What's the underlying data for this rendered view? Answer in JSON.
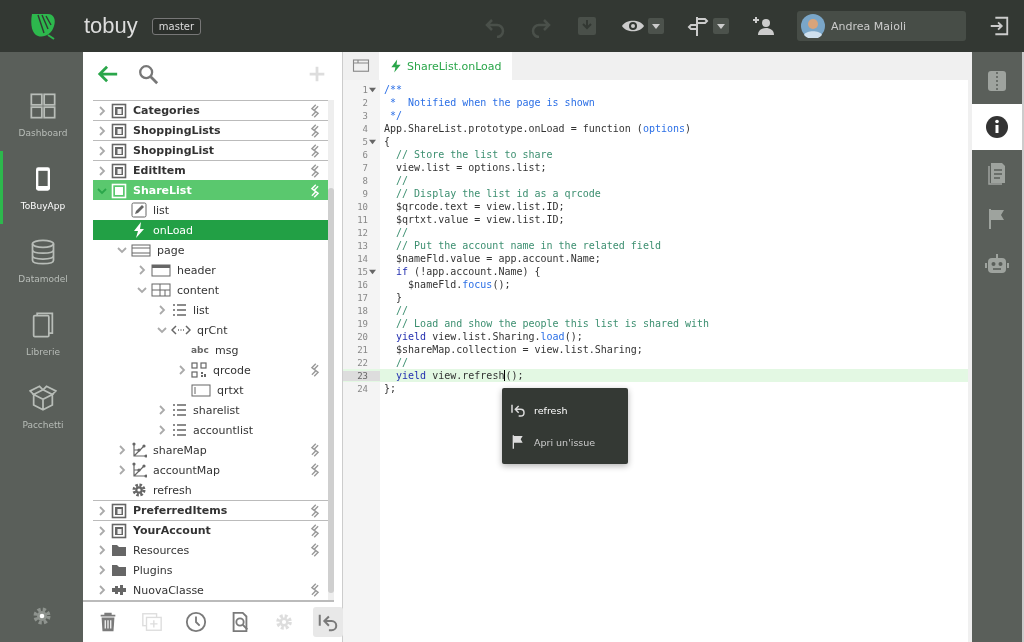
{
  "app": {
    "name": "tobuy",
    "branch": "master"
  },
  "toolbar": [
    {
      "disabled": true,
      "dropdown": false
    },
    {
      "disabled": true,
      "dropdown": false
    },
    {
      "disabled": true,
      "dropdown": false
    },
    {
      "disabled": false,
      "dropdown": true
    },
    {
      "disabled": false,
      "dropdown": true
    },
    {
      "disabled": false,
      "dropdown": false
    }
  ],
  "user": {
    "name": "Andrea Maioli"
  },
  "nav": [
    {
      "label": "Dashboard",
      "selected": false
    },
    {
      "label": "ToBuyApp",
      "selected": true
    },
    {
      "label": "Datamodel",
      "selected": false
    },
    {
      "label": "Librerie",
      "selected": false
    },
    {
      "label": "Pacchetti",
      "selected": false
    }
  ],
  "tree_toolbar": [
    {
      "disabled": false
    },
    {
      "disabled": false
    },
    {
      "disabled": true
    }
  ],
  "tree": [
    {
      "name": "Categories",
      "kind": "page",
      "expanded": false,
      "selected": false,
      "linked": true
    },
    {
      "name": "ShoppingLists",
      "kind": "page",
      "expanded": false,
      "selected": false,
      "linked": true
    },
    {
      "name": "ShoppingList",
      "kind": "page",
      "expanded": false,
      "selected": false,
      "linked": true
    },
    {
      "name": "EditItem",
      "kind": "page",
      "expanded": false,
      "selected": false,
      "linked": true
    },
    {
      "name": "ShareList",
      "kind": "page",
      "expanded": true,
      "selected": true,
      "linked": true,
      "children": [
        {
          "name": "list",
          "kind": "property",
          "selected": false,
          "linked": false
        },
        {
          "name": "onLoad",
          "kind": "event",
          "selected": true,
          "linked": false
        },
        {
          "name": "page",
          "kind": "layout",
          "expanded": true,
          "selected": false,
          "linked": false,
          "children": [
            {
              "name": "header",
              "kind": "header",
              "expanded": false,
              "selected": false,
              "linked": false
            },
            {
              "name": "content",
              "kind": "content",
              "expanded": true,
              "selected": false,
              "linked": false,
              "children": [
                {
                  "name": "list",
                  "kind": "list",
                  "expanded": false,
                  "selected": false,
                  "linked": false
                },
                {
                  "name": "qrCnt",
                  "kind": "container",
                  "expanded": true,
                  "selected": false,
                  "linked": false,
                  "children": [
                    {
                      "name": "msg",
                      "kind": "label",
                      "icon_text": "abc",
                      "selected": false,
                      "linked": false
                    },
                    {
                      "name": "qrcode",
                      "kind": "qrcode",
                      "expanded": false,
                      "selected": false,
                      "linked": true
                    },
                    {
                      "name": "qrtxt",
                      "kind": "input",
                      "selected": false,
                      "linked": false
                    }
                  ]
                },
                {
                  "name": "sharelist",
                  "kind": "list",
                  "expanded": false,
                  "selected": false,
                  "linked": false
                },
                {
                  "name": "accountlist",
                  "kind": "list",
                  "expanded": false,
                  "selected": false,
                  "linked": false
                }
              ]
            }
          ]
        },
        {
          "name": "shareMap",
          "kind": "map",
          "expanded": false,
          "selected": false,
          "linked": true
        },
        {
          "name": "accountMap",
          "kind": "map",
          "expanded": false,
          "selected": false,
          "linked": true
        },
        {
          "name": "refresh",
          "kind": "method",
          "selected": false,
          "linked": false
        }
      ]
    },
    {
      "name": "PreferredItems",
      "kind": "page",
      "expanded": false,
      "selected": false,
      "linked": true
    },
    {
      "name": "YourAccount",
      "kind": "page",
      "expanded": false,
      "selected": false,
      "linked": true
    },
    {
      "name": "Resources",
      "kind": "folder",
      "expanded": false,
      "selected": false,
      "linked": true
    },
    {
      "name": "Plugins",
      "kind": "folder",
      "expanded": false,
      "selected": false,
      "linked": false
    },
    {
      "name": "NuovaClasse",
      "kind": "class",
      "expanded": false,
      "selected": false,
      "linked": true
    }
  ],
  "tree_actions": [
    {
      "disabled": false,
      "pressed": false
    },
    {
      "disabled": true,
      "pressed": false
    },
    {
      "disabled": false,
      "pressed": false
    },
    {
      "disabled": false,
      "pressed": false
    },
    {
      "disabled": true,
      "pressed": false
    },
    {
      "disabled": false,
      "pressed": true
    }
  ],
  "editor": {
    "tab": "ShareList.onLoad",
    "lines": [
      {
        "num": "1",
        "fold": true,
        "active": false,
        "tokens": [
          {
            "t": "/**",
            "kind": "doc"
          }
        ]
      },
      {
        "num": "2",
        "fold": false,
        "active": false,
        "tokens": [
          {
            "t": " *  Notified when the page is shown",
            "kind": "doc"
          }
        ]
      },
      {
        "num": "3",
        "fold": false,
        "active": false,
        "tokens": [
          {
            "t": " */",
            "kind": "doc"
          }
        ]
      },
      {
        "num": "4",
        "fold": false,
        "active": false,
        "tokens": [
          {
            "t": "App.ShareList.prototype.onLoad = function (",
            "kind": "plain"
          },
          {
            "t": "options",
            "kind": "method"
          },
          {
            "t": ")",
            "kind": "plain"
          }
        ]
      },
      {
        "num": "5",
        "fold": true,
        "active": false,
        "tokens": [
          {
            "t": "{",
            "kind": "plain"
          }
        ]
      },
      {
        "num": "6",
        "fold": false,
        "active": false,
        "tokens": [
          {
            "t": "  // Store the list to share",
            "kind": "comment"
          }
        ]
      },
      {
        "num": "7",
        "fold": false,
        "active": false,
        "tokens": [
          {
            "t": "  view.list = options.list;",
            "kind": "plain"
          }
        ]
      },
      {
        "num": "8",
        "fold": false,
        "active": false,
        "tokens": [
          {
            "t": "  //",
            "kind": "comment"
          }
        ]
      },
      {
        "num": "9",
        "fold": false,
        "active": false,
        "tokens": [
          {
            "t": "  // Display the list id as a qrcode",
            "kind": "comment"
          }
        ]
      },
      {
        "num": "10",
        "fold": false,
        "active": false,
        "tokens": [
          {
            "t": "  $qrcode.text = view.list.ID;",
            "kind": "plain"
          }
        ]
      },
      {
        "num": "11",
        "fold": false,
        "active": false,
        "tokens": [
          {
            "t": "  $qrtxt.value = view.list.ID;",
            "kind": "plain"
          }
        ]
      },
      {
        "num": "12",
        "fold": false,
        "active": false,
        "tokens": [
          {
            "t": "  //",
            "kind": "comment"
          }
        ]
      },
      {
        "num": "13",
        "fold": false,
        "active": false,
        "tokens": [
          {
            "t": "  // Put the account name in the related field",
            "kind": "comment"
          }
        ]
      },
      {
        "num": "14",
        "fold": false,
        "active": false,
        "tokens": [
          {
            "t": "  $nameFld.value = app.account.Name;",
            "kind": "plain"
          }
        ]
      },
      {
        "num": "15",
        "fold": true,
        "active": false,
        "tokens": [
          {
            "t": "  if",
            "kind": "keyword"
          },
          {
            "t": " (!app.account.Name) {",
            "kind": "plain"
          }
        ]
      },
      {
        "num": "16",
        "fold": false,
        "active": false,
        "tokens": [
          {
            "t": "    $nameFld.",
            "kind": "plain"
          },
          {
            "t": "focus",
            "kind": "method"
          },
          {
            "t": "();",
            "kind": "plain"
          }
        ]
      },
      {
        "num": "17",
        "fold": false,
        "active": false,
        "tokens": [
          {
            "t": "  }",
            "kind": "plain"
          }
        ]
      },
      {
        "num": "18",
        "fold": false,
        "active": false,
        "tokens": [
          {
            "t": "  //",
            "kind": "comment"
          }
        ]
      },
      {
        "num": "19",
        "fold": false,
        "active": false,
        "tokens": [
          {
            "t": "  // Load and show the people this list is shared with",
            "kind": "comment"
          }
        ]
      },
      {
        "num": "20",
        "fold": false,
        "active": false,
        "tokens": [
          {
            "t": "  yield",
            "kind": "keyword"
          },
          {
            "t": " view.list.Sharing.",
            "kind": "plain"
          },
          {
            "t": "load",
            "kind": "method"
          },
          {
            "t": "();",
            "kind": "plain"
          }
        ]
      },
      {
        "num": "21",
        "fold": false,
        "active": false,
        "tokens": [
          {
            "t": "  $shareMap.collection = view.list.Sharing;",
            "kind": "plain"
          }
        ]
      },
      {
        "num": "22",
        "fold": false,
        "active": false,
        "tokens": [
          {
            "t": "  //",
            "kind": "comment"
          }
        ]
      },
      {
        "num": "23",
        "fold": false,
        "active": true,
        "tokens": [
          {
            "t": "  yield",
            "kind": "keyword"
          },
          {
            "t": " view.refresh",
            "kind": "plain"
          },
          {
            "t": "();",
            "kind": "plain",
            "caret_before": true
          }
        ]
      },
      {
        "num": "24",
        "fold": false,
        "active": false,
        "tokens": [
          {
            "t": "};",
            "kind": "plain"
          }
        ]
      }
    ],
    "popup": [
      {
        "label": "refresh"
      },
      {
        "label": "Apri un'issue"
      }
    ]
  },
  "right_rail": [
    {
      "selected": false
    },
    {
      "selected": true
    },
    {
      "selected": false
    },
    {
      "selected": false
    },
    {
      "selected": false
    }
  ]
}
